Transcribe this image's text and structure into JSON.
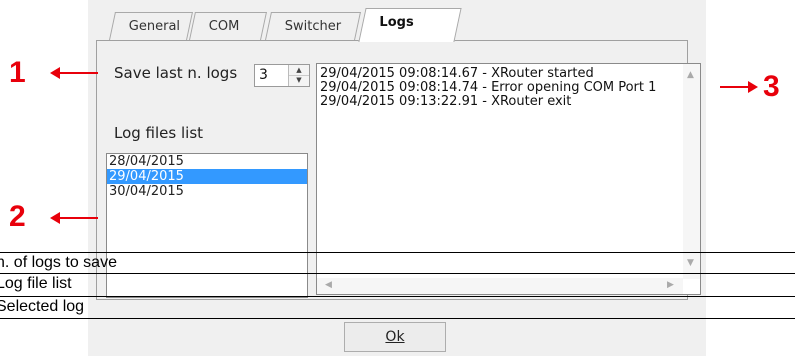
{
  "tabs": [
    {
      "label": "General",
      "active": false
    },
    {
      "label": "COM",
      "active": false
    },
    {
      "label": "Switcher",
      "active": false
    },
    {
      "label": "Logs",
      "active": true
    }
  ],
  "save_logs": {
    "label": "Save last n. logs",
    "value": "3"
  },
  "log_files": {
    "label": "Log files list",
    "items": [
      "28/04/2015",
      "29/04/2015",
      "30/04/2015"
    ],
    "selected": "29/04/2015"
  },
  "log_lines": [
    "29/04/2015 09:08:14.67 - XRouter started",
    "29/04/2015 09:08:14.74 - Error opening COM Port 1",
    "29/04/2015 09:13:22.91 - XRouter exit"
  ],
  "annotations": {
    "one": "1",
    "two": "2",
    "three": "3"
  },
  "legend": [
    "n. of logs to save",
    "Log file list",
    "Selected log"
  ],
  "ok_button": {
    "label": "Ok"
  },
  "colors": {
    "annotation": "#e8000b",
    "selection": "#3399ff"
  }
}
